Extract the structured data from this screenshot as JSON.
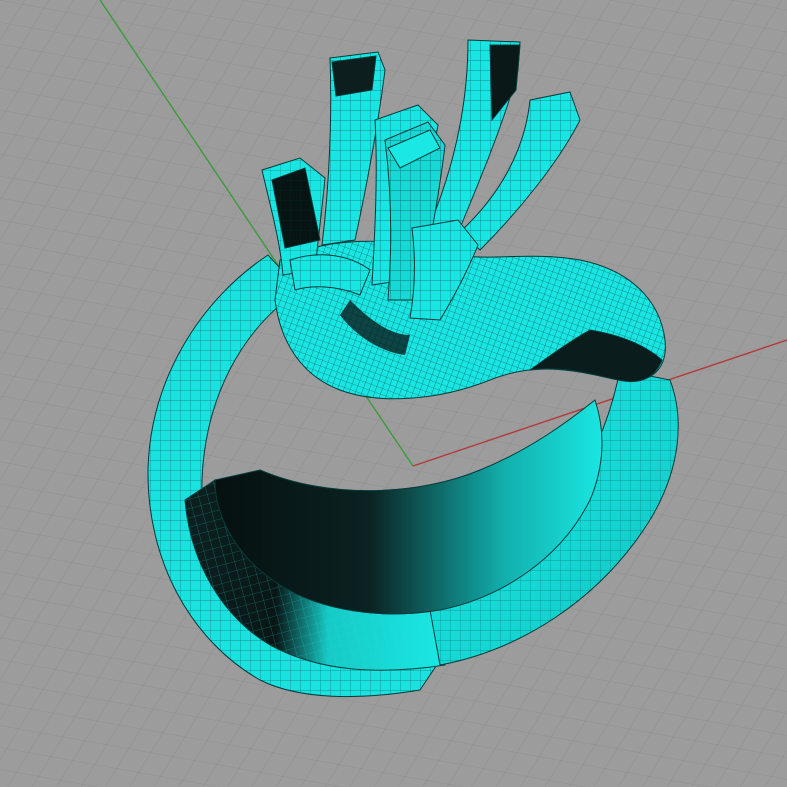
{
  "viewport": {
    "projection": "perspective",
    "display_mode": "shaded-with-wireframe",
    "grid": true,
    "colors": {
      "background": "#9c9c9c",
      "grid_minor": "#8c8c8c",
      "grid_major": "#7a7a7a",
      "axis_x": "#b43a3a",
      "axis_y": "#3c9a3c",
      "object_fill": "#19e6e3",
      "object_shadow": "#0a1a1a",
      "object_wire": "#063a3a"
    },
    "object": {
      "type": "ring",
      "parts": [
        "shank",
        "crown",
        "prong",
        "prong",
        "prong",
        "prong",
        "prong",
        "prong"
      ]
    }
  }
}
